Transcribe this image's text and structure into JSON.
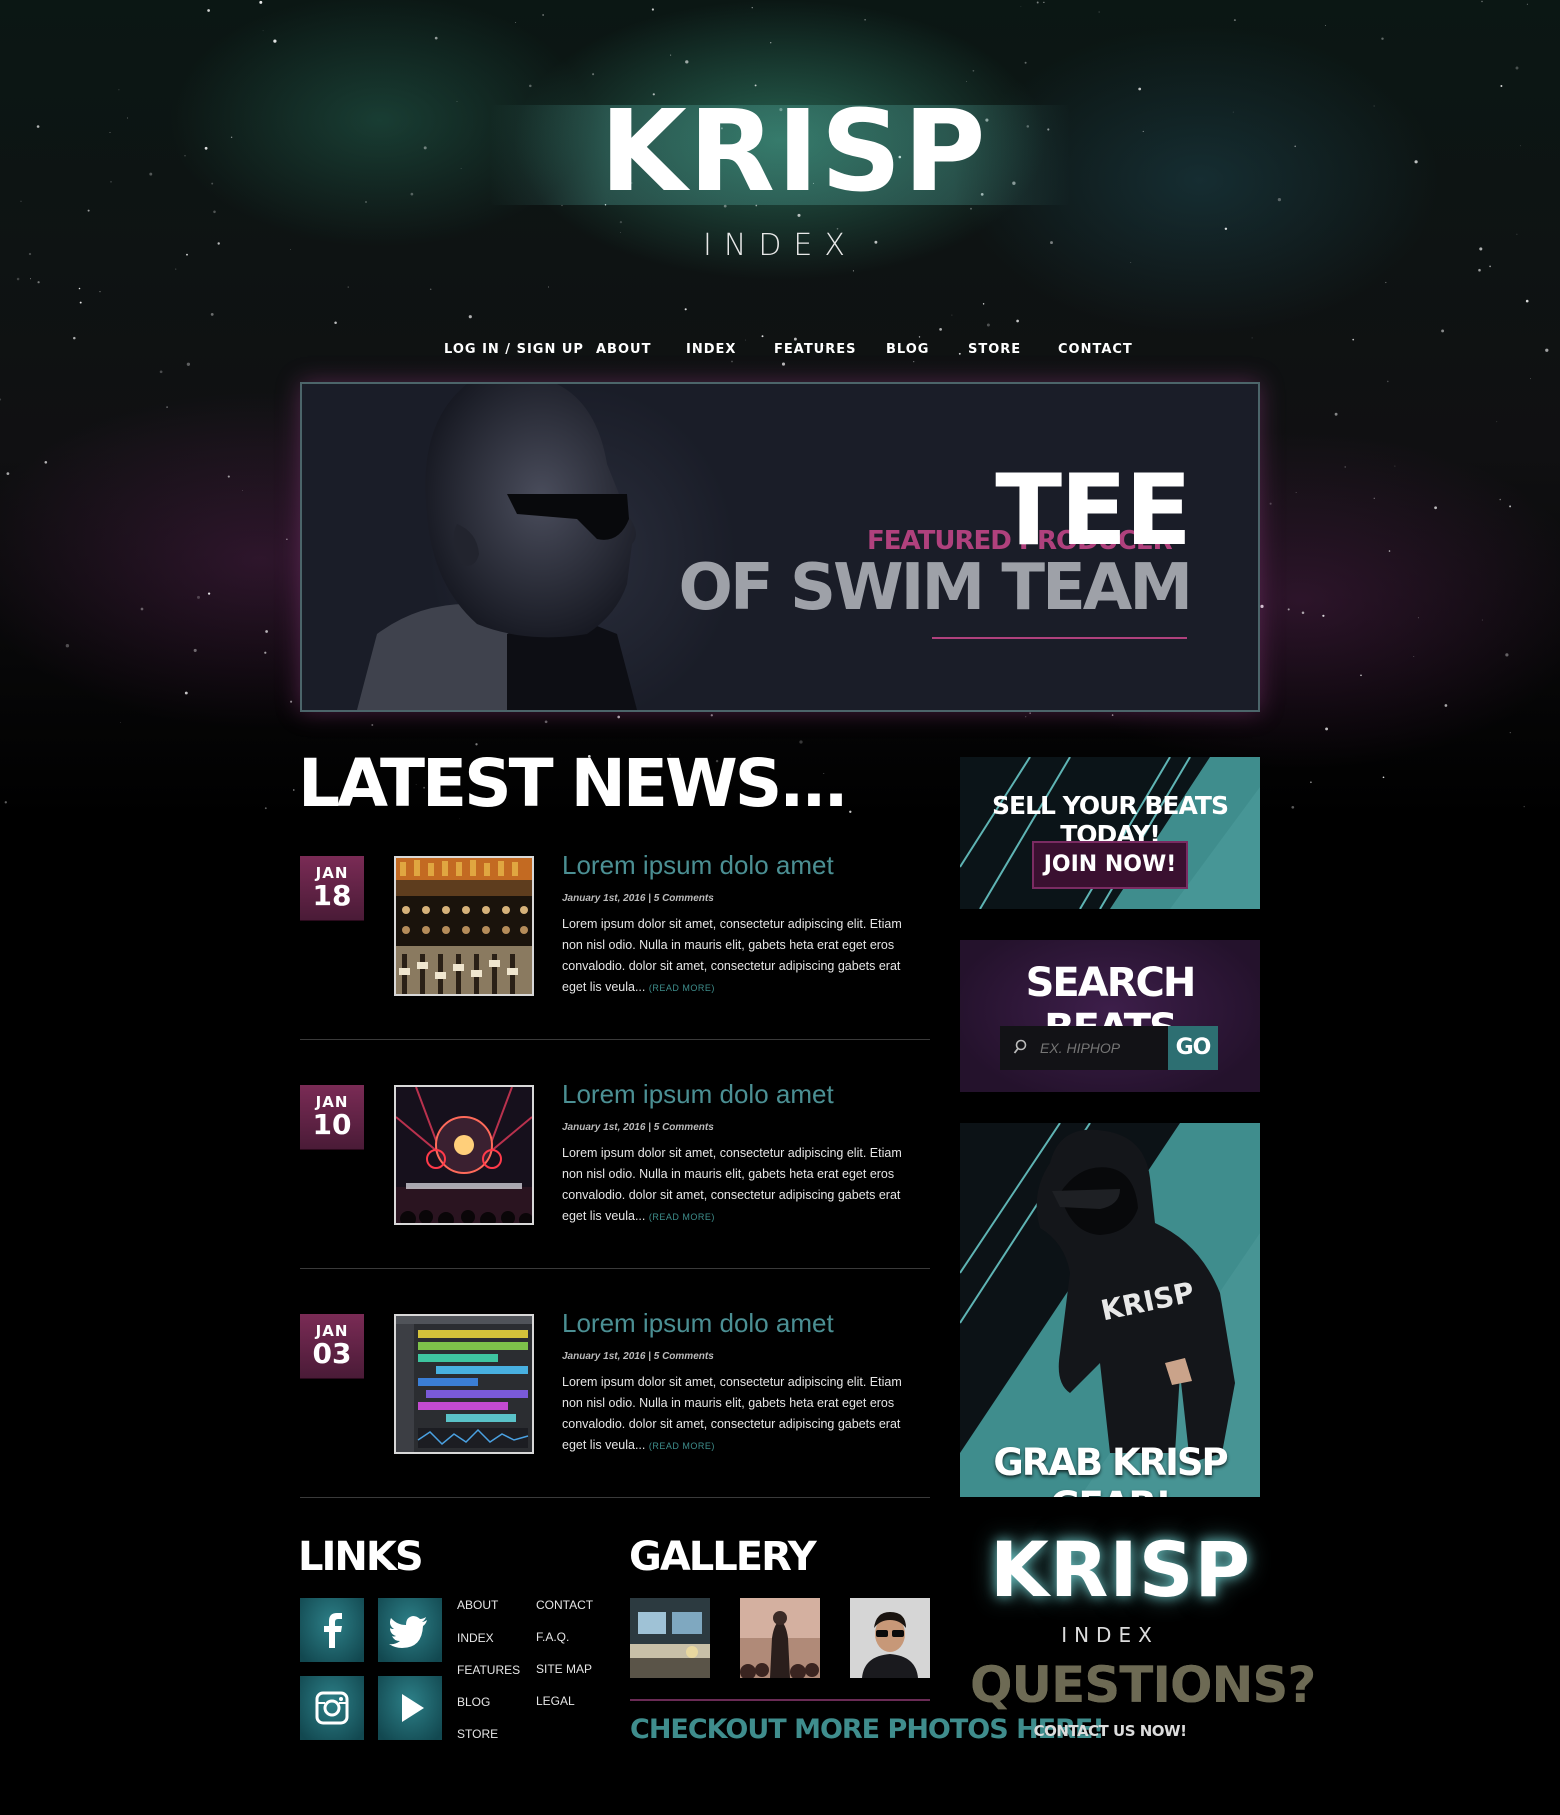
{
  "header": {
    "logo": "KRISP",
    "logo_sub": "INDEX"
  },
  "nav": {
    "items": [
      {
        "label": "LOG IN / SIGN UP"
      },
      {
        "label": "ABOUT"
      },
      {
        "label": "INDEX"
      },
      {
        "label": "FEATURES"
      },
      {
        "label": "BLOG"
      },
      {
        "label": "STORE"
      },
      {
        "label": "CONTACT"
      }
    ]
  },
  "hero": {
    "featured_label": "FEATURED PRODUCER",
    "name": "TEE",
    "subtitle": "OF SWIM TEAM"
  },
  "news": {
    "title": "LATEST NEWS...",
    "posts": [
      {
        "month": "JAN",
        "day": "18",
        "title": "Lorem ipsum dolo amet",
        "meta": "January 1st, 2016  |  5 Comments",
        "body": "Lorem ipsum dolor sit amet, consectetur adipiscing elit. Etiam non nisl odio. Nulla in mauris elit, gabets heta erat eget eros convalodio. dolor sit amet, consectetur adipiscing gabets erat eget lis veula...",
        "read_more": "(READ MORE)",
        "image": "mixing-console-image"
      },
      {
        "month": "JAN",
        "day": "10",
        "title": "Lorem ipsum dolo amet",
        "meta": "January 1st, 2016  |  5 Comments",
        "body": "Lorem ipsum dolor sit amet, consectetur adipiscing elit. Etiam non nisl odio. Nulla in mauris elit, gabets heta erat eget eros convalodio. dolor sit amet, consectetur adipiscing gabets erat eget lis veula...",
        "read_more": "(READ MORE)",
        "image": "concert-stage-image"
      },
      {
        "month": "JAN",
        "day": "03",
        "title": "Lorem ipsum dolo amet",
        "meta": "January 1st, 2016  |  5 Comments",
        "body": "Lorem ipsum dolor sit amet, consectetur adipiscing elit. Etiam non nisl odio. Nulla in mauris elit, gabets heta erat eget eros convalodio. dolor sit amet, consectetur adipiscing gabets erat eget lis veula...",
        "read_more": "(READ MORE)",
        "image": "daw-screenshot-image"
      }
    ]
  },
  "sidebar": {
    "sell_title": "SELL YOUR BEATS TODAY!",
    "join_label": "JOIN NOW!",
    "search_title": "SEARCH BEATS",
    "search_placeholder": "EX. HIPHOP",
    "go_label": "GO",
    "gear_title": "GRAB KRISP GEAR!",
    "gear_hoodie_text": "KRISP"
  },
  "footer": {
    "links_title": "LINKS",
    "social": [
      "facebook-icon",
      "twitter-icon",
      "instagram-icon",
      "youtube-icon"
    ],
    "links_col1": [
      "ABOUT",
      "INDEX",
      "FEATURES",
      "BLOG",
      "STORE"
    ],
    "links_col2": [
      "CONTACT",
      "F.A.Q.",
      "SITE MAP",
      "LEGAL"
    ],
    "gallery_title": "GALLERY",
    "gallery_cta": "CHECKOUT  MORE  PHOTOS HERE!",
    "logo": "KRISP",
    "logo_sub": "INDEX",
    "questions": "QUESTIONS?",
    "contact_now": "CONTACT US NOW!"
  },
  "colors": {
    "accent_teal": "#4b8f93",
    "accent_magenta": "#b0417d",
    "date_box": "#7a2b55"
  }
}
